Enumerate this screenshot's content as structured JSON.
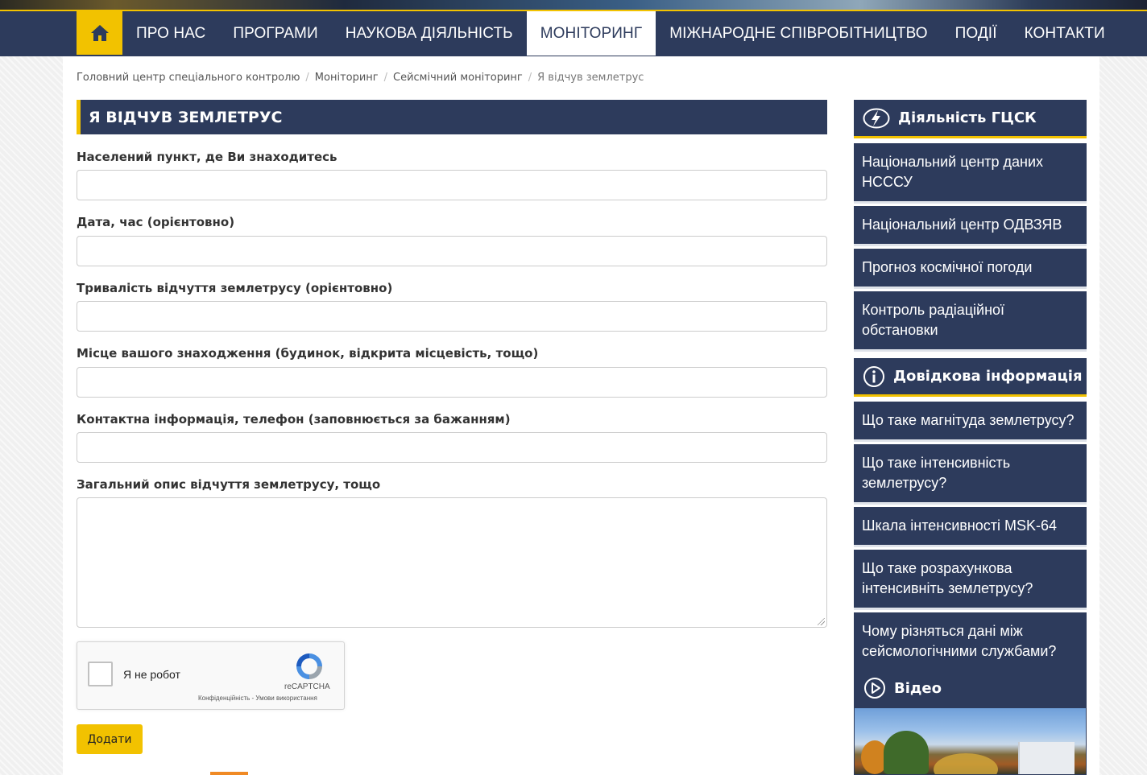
{
  "nav": {
    "home_icon": "home-icon",
    "items": [
      {
        "label": "ПРО НАС"
      },
      {
        "label": "ПРОГРАМИ"
      },
      {
        "label": "НАУКОВА ДІЯЛЬНІСТЬ"
      },
      {
        "label": "МОНІТОРИНГ",
        "active": true
      },
      {
        "label": "МІЖНАРОДНЕ СПІВРОБІТНИЦТВО"
      },
      {
        "label": "ПОДІЇ"
      },
      {
        "label": "КОНТАКТИ"
      }
    ]
  },
  "breadcrumb": {
    "items": [
      "Головний центр спеціального контролю",
      "Моніторинг",
      "Сейсмічний моніторинг",
      "Я відчув землетрус"
    ],
    "separator": "/"
  },
  "form": {
    "title": "Я ВІДЧУВ ЗЕМЛЕТРУС",
    "fields": [
      {
        "label": "Населений пункт, де Ви знаходитесь",
        "value": ""
      },
      {
        "label": "Дата, час (орієнтовно)",
        "value": ""
      },
      {
        "label": "Тривалість відчуття землетрусу (орієнтовно)",
        "value": ""
      },
      {
        "label": "Місце вашого знаходження (будинок, відкрита місцевість, тощо)",
        "value": ""
      },
      {
        "label": "Контактна інформація, телефон (заповнюється за бажанням)",
        "value": ""
      }
    ],
    "description_label": "Загальний опис відчуття землетрусу, тощо",
    "description_value": "",
    "recaptcha": {
      "label": "Я не робот",
      "brand": "reCAPTCHA",
      "links": "Конфіденційність - Умови використання"
    },
    "submit_label": "Додати"
  },
  "sidebar": {
    "activity": {
      "title": "Діяльність ГЦСК",
      "icon": "lightning-icon",
      "links": [
        "Національний центр даних НСССУ",
        "Національний центр ОДВЗЯВ",
        "Прогноз космічної погоди",
        "Контроль радіаційної обстановки"
      ]
    },
    "reference": {
      "title": "Довідкова інформація",
      "icon": "info-icon",
      "links": [
        "Що таке магнітуда землетрусу?",
        "Що таке інтенсивність землетрусу?",
        "Шкала інтенсивності MSK-64",
        "Що таке розрахункова інтенсивніть землетрусу?",
        "Чому різняться дані між сейсмологічними службами?"
      ]
    },
    "video": {
      "title": "Відео",
      "icon": "play-icon"
    }
  },
  "colors": {
    "navy": "#2d3b5c",
    "accent": "#f2c200"
  }
}
